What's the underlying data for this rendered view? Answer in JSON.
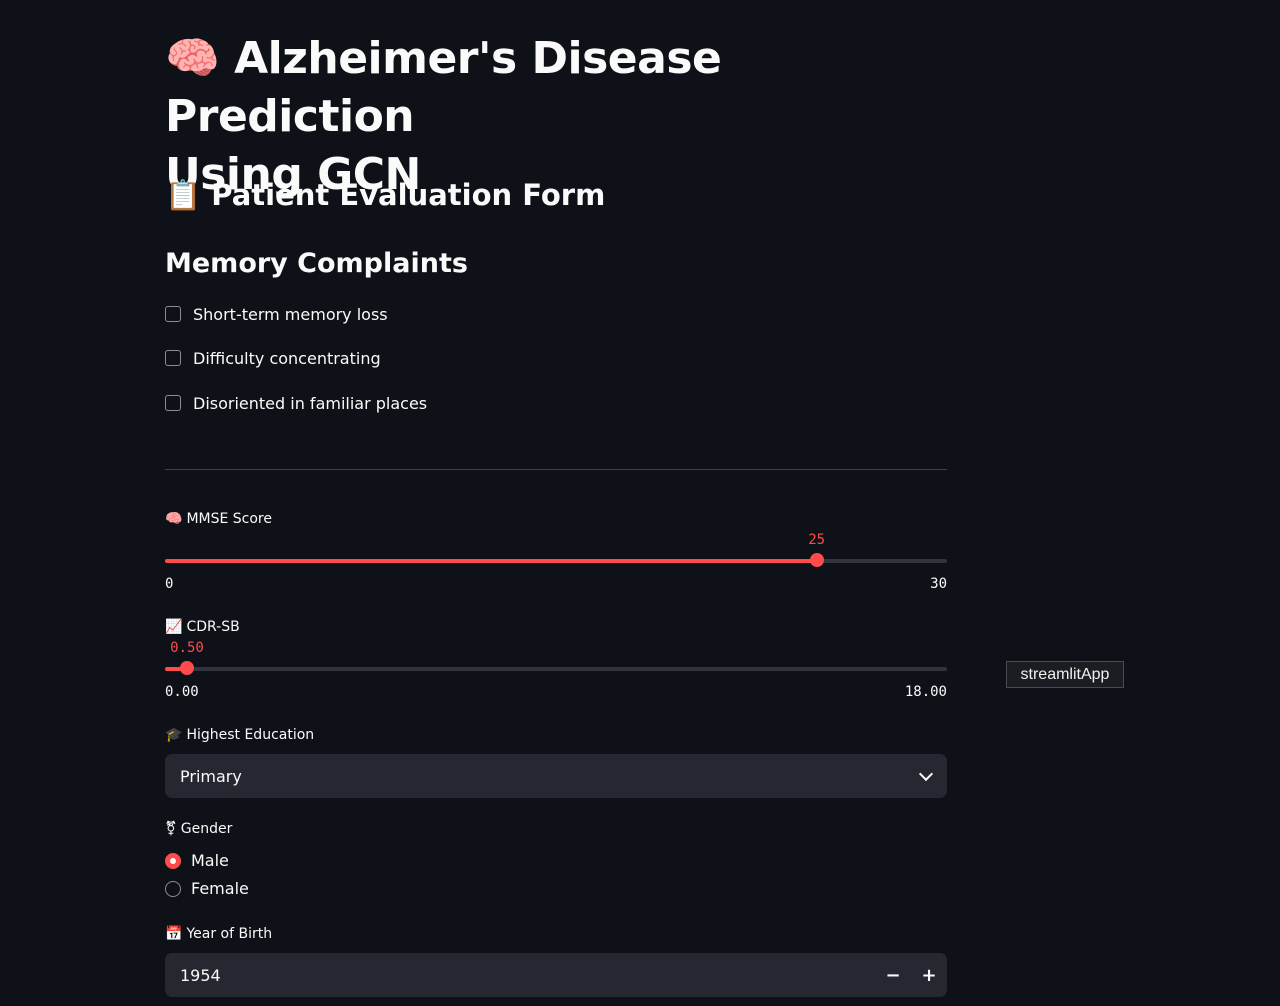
{
  "header": {
    "title_icon": "🧠",
    "title_line1": "Alzheimer's Disease Prediction",
    "title_line2": "Using GCN"
  },
  "form": {
    "icon": "📋",
    "title": "Patient Evaluation Form"
  },
  "memory": {
    "title": "Memory Complaints",
    "items": [
      {
        "label": "Short-term memory loss",
        "checked": false
      },
      {
        "label": "Difficulty concentrating",
        "checked": false
      },
      {
        "label": "Disoriented in familiar places",
        "checked": false
      }
    ]
  },
  "mmse": {
    "icon": "🧠",
    "label": "MMSE Score",
    "value": "25",
    "min": "0",
    "max": "30",
    "fraction": 0.8333
  },
  "cdr": {
    "icon": "📈",
    "label": "CDR-SB",
    "value": "0.50",
    "min": "0.00",
    "max": "18.00",
    "fraction": 0.0278
  },
  "education": {
    "icon": "🎓",
    "label": "Highest Education",
    "selected": "Primary"
  },
  "gender": {
    "icon": "⚧",
    "label": "Gender",
    "options": [
      {
        "label": "Male",
        "selected": true
      },
      {
        "label": "Female",
        "selected": false
      }
    ]
  },
  "birth": {
    "icon": "📅",
    "label": "Year of Birth",
    "value": "1954",
    "minus": "−",
    "plus": "+"
  },
  "tooltip": {
    "text": "streamlitApp"
  },
  "colors": {
    "background": "#0e1117",
    "accent": "#ff4b4b",
    "input_bg": "#262730"
  }
}
